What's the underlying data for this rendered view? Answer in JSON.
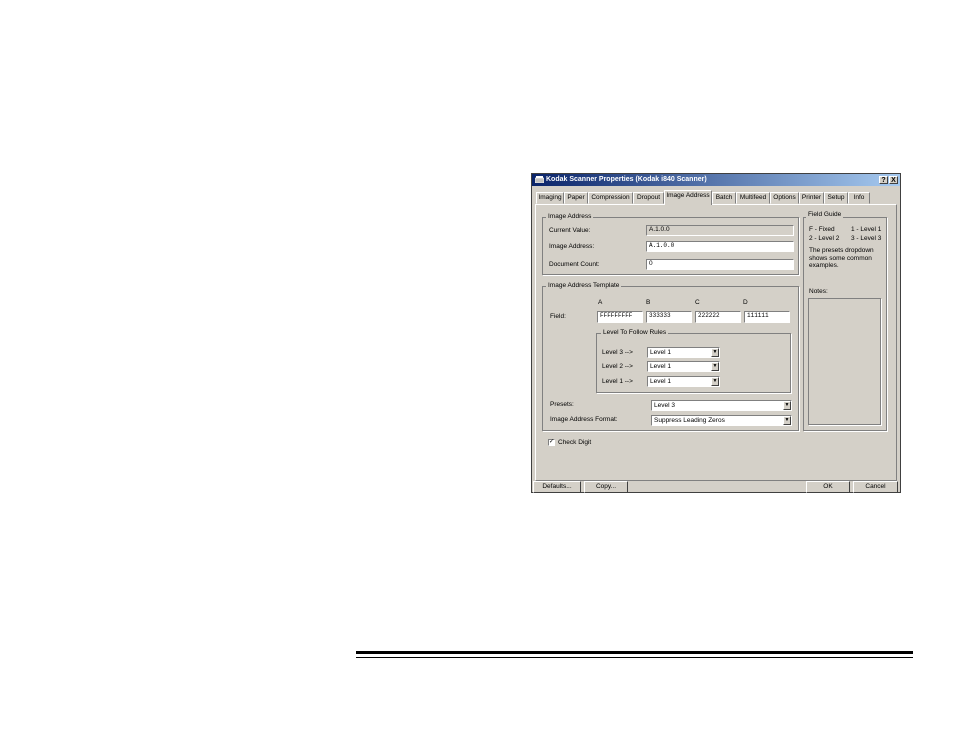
{
  "dialog": {
    "title": "Kodak Scanner Properties (Kodak i840 Scanner)",
    "help_btn": "?",
    "close_btn": "X",
    "tabs": [
      "Imaging",
      "Paper",
      "Compression",
      "Dropout",
      "Image Address",
      "Batch",
      "Multifeed",
      "Options",
      "Printer",
      "Setup",
      "Info"
    ],
    "active_tab": "Image Address"
  },
  "image_address": {
    "group_label": "Image Address",
    "current_value_label": "Current Value:",
    "current_value": "A.1.0.0",
    "image_address_label": "Image Address:",
    "image_address_value": "A.1.0.0",
    "document_count_label": "Document Count:",
    "document_count_value": "0"
  },
  "template": {
    "group_label": "Image Address Template",
    "columns": [
      "A",
      "B",
      "C",
      "D"
    ],
    "field_label": "Field:",
    "fields": [
      "FFFFFFFFF",
      "333333",
      "222222",
      "111111"
    ],
    "rules_label": "Level To Follow Rules",
    "rules": [
      {
        "label": "Level 3 -->",
        "value": "Level 1"
      },
      {
        "label": "Level 2 -->",
        "value": "Level 1"
      },
      {
        "label": "Level 1 -->",
        "value": "Level 1"
      }
    ],
    "presets_label": "Presets:",
    "presets_value": "Level 3",
    "format_label": "Image Address Format:",
    "format_value": "Suppress Leading Zeros"
  },
  "check_digit": {
    "label": "Check Digit",
    "checked": true,
    "mark": "✓"
  },
  "field_guide": {
    "label": "Field Guide",
    "items": [
      "F - Fixed",
      "1 - Level 1",
      "2 - Level 2",
      "3 - Level 3"
    ],
    "note": "The presets dropdown shows some common examples.",
    "notes_label": "Notes:"
  },
  "buttons": {
    "defaults": "Defaults...",
    "copy": "Copy...",
    "ok": "OK",
    "cancel": "Cancel"
  }
}
